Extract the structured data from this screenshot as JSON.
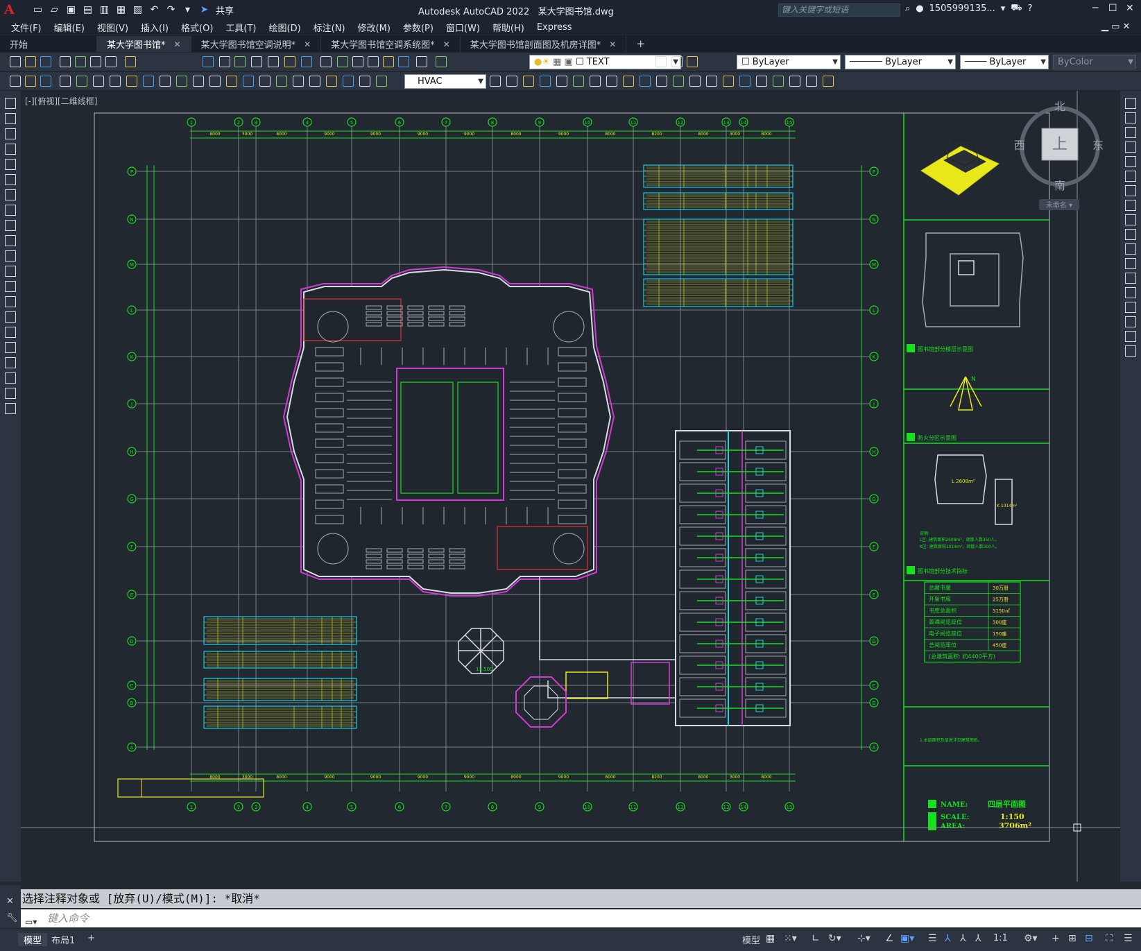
{
  "app": {
    "logo": "A",
    "title": "Autodesk AutoCAD 2022",
    "filename": "某大学图书馆.dwg",
    "share": "共享",
    "search_placeholder": "键入关键字或短语",
    "user": "1505999135...",
    "win_min": "─",
    "win_max": "☐",
    "win_close": "✕"
  },
  "menu": [
    "文件(F)",
    "编辑(E)",
    "视图(V)",
    "插入(I)",
    "格式(O)",
    "工具(T)",
    "绘图(D)",
    "标注(N)",
    "修改(M)",
    "参数(P)",
    "窗口(W)",
    "帮助(H)",
    "Express"
  ],
  "tabs": [
    {
      "label": "开始",
      "closable": false,
      "active": false
    },
    {
      "label": "某大学图书馆*",
      "closable": true,
      "active": true
    },
    {
      "label": "某大学图书馆空调说明*",
      "closable": true,
      "active": false
    },
    {
      "label": "某大学图书馆空调系统图*",
      "closable": true,
      "active": false
    },
    {
      "label": "某大学图书馆剖面图及机房详图*",
      "closable": true,
      "active": false
    }
  ],
  "tab_add": "+",
  "tab_close": "✕",
  "toolbar": {
    "layer_combo": "TEXT",
    "color_combo": "ByLayer",
    "linetype_combo": "ByLayer",
    "lineweight_combo": "ByLayer",
    "plotstyle_combo": "ByColor",
    "style_combo": "HVAC"
  },
  "viewport": {
    "label": "[-][俯视][二维线框]",
    "viewcube": {
      "north": "北",
      "south": "南",
      "east": "东",
      "west": "西",
      "top": "上",
      "wcs": "未命名 ▾"
    }
  },
  "drawing": {
    "axis_numbers": [
      "1",
      "2",
      "3",
      "4",
      "5",
      "6",
      "7",
      "8",
      "9",
      "10",
      "11",
      "12",
      "13",
      "14",
      "15"
    ],
    "axis_letters": [
      "P",
      "N",
      "M",
      "L",
      "K",
      "J",
      "H",
      "G",
      "F",
      "E",
      "D",
      "C",
      "B",
      "A"
    ],
    "dims_top": [
      "8000",
      "3000",
      "8000",
      "9000",
      "9000",
      "9000",
      "9000",
      "8000",
      "9000",
      "8000",
      "8200",
      "8000",
      "3000",
      "8000"
    ],
    "legend_1": "图书馆部分楼层示意图",
    "legend_2": "防火分区示意图",
    "legend_3": "图书馆部分技术指标",
    "fire_area_L": "L 2608m²",
    "fire_area_K": "K 1014m²",
    "notes_title": "说明:",
    "notes_1": "L区: 建筑面积2608m²，疏散人数350人。",
    "notes_2": "K区: 建筑面积1014m²，疏散人数300人。",
    "notes_3": "1.本层面积及层高详见建筑图纸。",
    "tech_rows": [
      [
        "总藏书量",
        "30万册"
      ],
      [
        "开架书库",
        "25万册"
      ],
      [
        "书库总面积",
        "3150㎡"
      ],
      [
        "普通阅览座位",
        "300座"
      ],
      [
        "电子阅览座位",
        "150座"
      ],
      [
        "总阅览座位",
        "450座"
      ],
      [
        "(总建筑面积: 约4400平方)",
        ""
      ]
    ],
    "name_label": "NAME:",
    "name_value": "四层平面图",
    "scale_label": "SCALE:",
    "scale_value": "1:150",
    "area_label": "AREA:",
    "area_value": "3706m²",
    "octagon_label": "13.500",
    "compass_n": "N"
  },
  "command": {
    "history": "选择注释对象或 [放弃(U)/模式(M)]: *取消*",
    "placeholder": "键入命令"
  },
  "status": {
    "tab_model": "模型",
    "tab_layout": "布局1",
    "tab_add": "+",
    "model_btn": "模型",
    "scale": "1:1"
  },
  "colors": {
    "accent": "#0aa0ff",
    "grid": "#7f8691",
    "green": "#17e01d",
    "cyan": "#17d0e0",
    "yellow": "#e8e81a",
    "magenta": "#d33ad3",
    "red": "#e03030"
  }
}
